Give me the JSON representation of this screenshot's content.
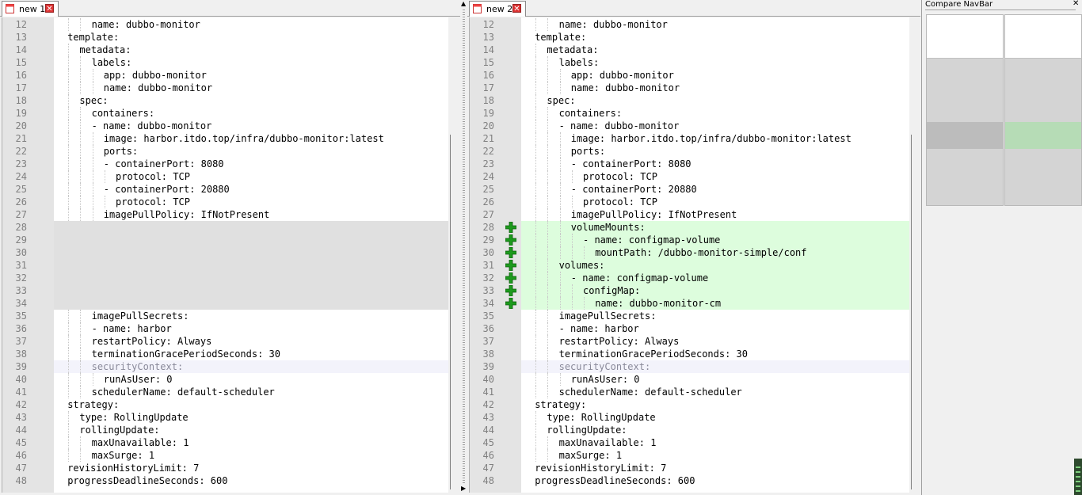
{
  "colors": {
    "added_bg": "#ddfddd",
    "blank_bg": "#e0e0e0",
    "highlight_bg": "#f3f3fb",
    "nav_added": "#b6dcb6",
    "nav_blank": "#bcbcbc",
    "plus_icon": "#1d9a1d"
  },
  "tabs": {
    "left": {
      "label": "new 1",
      "close": "✕",
      "icon": "file-icon"
    },
    "right": {
      "label": "new 2",
      "close": "✕",
      "icon": "file-icon"
    }
  },
  "navbar": {
    "title": "Compare NavBar",
    "close": "✕"
  },
  "left_lines": [
    {
      "n": "12",
      "indent": 3,
      "text": "name: dubbo-monitor",
      "kind": "normal"
    },
    {
      "n": "13",
      "indent": 1,
      "text": "template:",
      "kind": "normal"
    },
    {
      "n": "14",
      "indent": 2,
      "text": "metadata:",
      "kind": "normal"
    },
    {
      "n": "15",
      "indent": 3,
      "text": "labels:",
      "kind": "normal"
    },
    {
      "n": "16",
      "indent": 4,
      "text": "app: dubbo-monitor",
      "kind": "normal"
    },
    {
      "n": "17",
      "indent": 4,
      "text": "name: dubbo-monitor",
      "kind": "normal"
    },
    {
      "n": "18",
      "indent": 2,
      "text": "spec:",
      "kind": "normal"
    },
    {
      "n": "19",
      "indent": 3,
      "text": "containers:",
      "kind": "normal"
    },
    {
      "n": "20",
      "indent": 3,
      "text": "- name: dubbo-monitor",
      "kind": "normal"
    },
    {
      "n": "21",
      "indent": 4,
      "text": "image: harbor.itdo.top/infra/dubbo-monitor:latest",
      "kind": "normal"
    },
    {
      "n": "22",
      "indent": 4,
      "text": "ports:",
      "kind": "normal"
    },
    {
      "n": "23",
      "indent": 4,
      "text": "- containerPort: 8080",
      "kind": "normal"
    },
    {
      "n": "24",
      "indent": 5,
      "text": "protocol: TCP",
      "kind": "normal"
    },
    {
      "n": "25",
      "indent": 4,
      "text": "- containerPort: 20880",
      "kind": "normal"
    },
    {
      "n": "26",
      "indent": 5,
      "text": "protocol: TCP",
      "kind": "normal"
    },
    {
      "n": "27",
      "indent": 4,
      "text": "imagePullPolicy: IfNotPresent",
      "kind": "normal"
    },
    {
      "n": "28",
      "indent": 0,
      "text": "",
      "kind": "blank"
    },
    {
      "n": "29",
      "indent": 0,
      "text": "",
      "kind": "blank"
    },
    {
      "n": "30",
      "indent": 0,
      "text": "",
      "kind": "blank"
    },
    {
      "n": "31",
      "indent": 0,
      "text": "",
      "kind": "blank"
    },
    {
      "n": "32",
      "indent": 0,
      "text": "",
      "kind": "blank"
    },
    {
      "n": "33",
      "indent": 0,
      "text": "",
      "kind": "blank"
    },
    {
      "n": "34",
      "indent": 0,
      "text": "",
      "kind": "blank"
    },
    {
      "n": "35",
      "indent": 3,
      "text": "imagePullSecrets:",
      "kind": "normal"
    },
    {
      "n": "36",
      "indent": 3,
      "text": "- name: harbor",
      "kind": "normal"
    },
    {
      "n": "37",
      "indent": 3,
      "text": "restartPolicy: Always",
      "kind": "normal"
    },
    {
      "n": "38",
      "indent": 3,
      "text": "terminationGracePeriodSeconds: 30",
      "kind": "normal"
    },
    {
      "n": "39",
      "indent": 3,
      "text": "securityContext:",
      "kind": "hl"
    },
    {
      "n": "40",
      "indent": 4,
      "text": "runAsUser: 0",
      "kind": "normal"
    },
    {
      "n": "41",
      "indent": 3,
      "text": "schedulerName: default-scheduler",
      "kind": "normal"
    },
    {
      "n": "42",
      "indent": 1,
      "text": "strategy:",
      "kind": "normal"
    },
    {
      "n": "43",
      "indent": 2,
      "text": "type: RollingUpdate",
      "kind": "normal"
    },
    {
      "n": "44",
      "indent": 2,
      "text": "rollingUpdate:",
      "kind": "normal"
    },
    {
      "n": "45",
      "indent": 3,
      "text": "maxUnavailable: 1",
      "kind": "normal"
    },
    {
      "n": "46",
      "indent": 3,
      "text": "maxSurge: 1",
      "kind": "normal"
    },
    {
      "n": "47",
      "indent": 1,
      "text": "revisionHistoryLimit: 7",
      "kind": "normal"
    },
    {
      "n": "48",
      "indent": 1,
      "text": "progressDeadlineSeconds: 600",
      "kind": "normal"
    }
  ],
  "right_lines": [
    {
      "n": "12",
      "indent": 3,
      "text": "name: dubbo-monitor",
      "kind": "normal"
    },
    {
      "n": "13",
      "indent": 1,
      "text": "template:",
      "kind": "normal"
    },
    {
      "n": "14",
      "indent": 2,
      "text": "metadata:",
      "kind": "normal"
    },
    {
      "n": "15",
      "indent": 3,
      "text": "labels:",
      "kind": "normal"
    },
    {
      "n": "16",
      "indent": 4,
      "text": "app: dubbo-monitor",
      "kind": "normal"
    },
    {
      "n": "17",
      "indent": 4,
      "text": "name: dubbo-monitor",
      "kind": "normal"
    },
    {
      "n": "18",
      "indent": 2,
      "text": "spec:",
      "kind": "normal"
    },
    {
      "n": "19",
      "indent": 3,
      "text": "containers:",
      "kind": "normal"
    },
    {
      "n": "20",
      "indent": 3,
      "text": "- name: dubbo-monitor",
      "kind": "normal"
    },
    {
      "n": "21",
      "indent": 4,
      "text": "image: harbor.itdo.top/infra/dubbo-monitor:latest",
      "kind": "normal"
    },
    {
      "n": "22",
      "indent": 4,
      "text": "ports:",
      "kind": "normal"
    },
    {
      "n": "23",
      "indent": 4,
      "text": "- containerPort: 8080",
      "kind": "normal"
    },
    {
      "n": "24",
      "indent": 5,
      "text": "protocol: TCP",
      "kind": "normal"
    },
    {
      "n": "25",
      "indent": 4,
      "text": "- containerPort: 20880",
      "kind": "normal"
    },
    {
      "n": "26",
      "indent": 5,
      "text": "protocol: TCP",
      "kind": "normal"
    },
    {
      "n": "27",
      "indent": 4,
      "text": "imagePullPolicy: IfNotPresent",
      "kind": "normal"
    },
    {
      "n": "28",
      "indent": 4,
      "text": "volumeMounts:",
      "kind": "added"
    },
    {
      "n": "29",
      "indent": 5,
      "text": "- name: configmap-volume",
      "kind": "added"
    },
    {
      "n": "30",
      "indent": 6,
      "text": "mountPath: /dubbo-monitor-simple/conf",
      "kind": "added"
    },
    {
      "n": "31",
      "indent": 3,
      "text": "volumes:",
      "kind": "added"
    },
    {
      "n": "32",
      "indent": 4,
      "text": "- name: configmap-volume",
      "kind": "added"
    },
    {
      "n": "33",
      "indent": 5,
      "text": "configMap:",
      "kind": "added"
    },
    {
      "n": "34",
      "indent": 6,
      "text": "name: dubbo-monitor-cm",
      "kind": "added"
    },
    {
      "n": "35",
      "indent": 3,
      "text": "imagePullSecrets:",
      "kind": "normal"
    },
    {
      "n": "36",
      "indent": 3,
      "text": "- name: harbor",
      "kind": "normal"
    },
    {
      "n": "37",
      "indent": 3,
      "text": "restartPolicy: Always",
      "kind": "normal"
    },
    {
      "n": "38",
      "indent": 3,
      "text": "terminationGracePeriodSeconds: 30",
      "kind": "normal"
    },
    {
      "n": "39",
      "indent": 3,
      "text": "securityContext:",
      "kind": "hl"
    },
    {
      "n": "40",
      "indent": 4,
      "text": "runAsUser: 0",
      "kind": "normal"
    },
    {
      "n": "41",
      "indent": 3,
      "text": "schedulerName: default-scheduler",
      "kind": "normal"
    },
    {
      "n": "42",
      "indent": 1,
      "text": "strategy:",
      "kind": "normal"
    },
    {
      "n": "43",
      "indent": 2,
      "text": "type: RollingUpdate",
      "kind": "normal"
    },
    {
      "n": "44",
      "indent": 2,
      "text": "rollingUpdate:",
      "kind": "normal"
    },
    {
      "n": "45",
      "indent": 3,
      "text": "maxUnavailable: 1",
      "kind": "normal"
    },
    {
      "n": "46",
      "indent": 3,
      "text": "maxSurge: 1",
      "kind": "normal"
    },
    {
      "n": "47",
      "indent": 1,
      "text": "revisionHistoryLimit: 7",
      "kind": "normal"
    },
    {
      "n": "48",
      "indent": 1,
      "text": "progressDeadlineSeconds: 600",
      "kind": "normal"
    }
  ]
}
